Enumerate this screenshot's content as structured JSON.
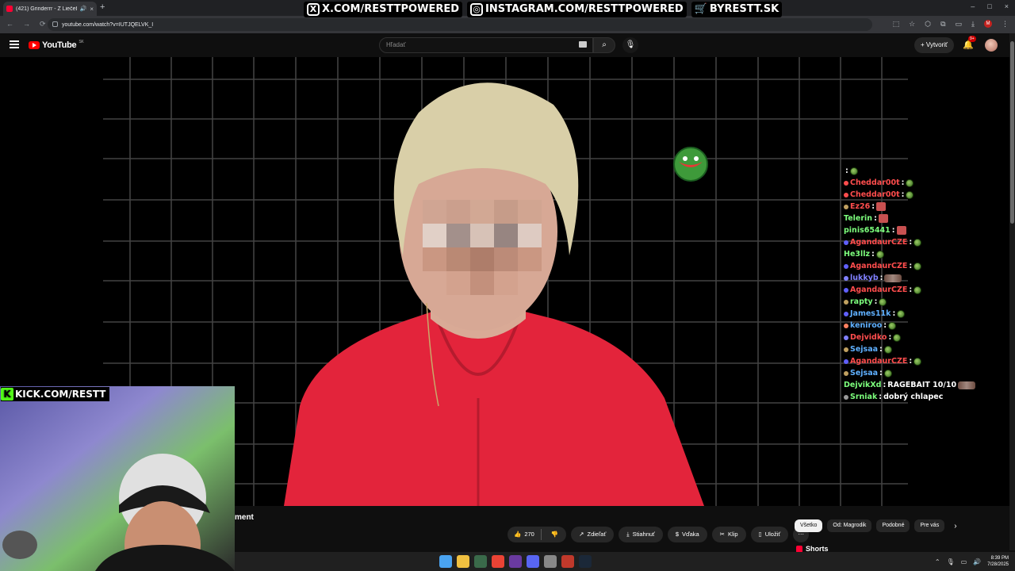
{
  "browser": {
    "tab_title": "(421) Grinderrr - Z Liečebr",
    "tab_close": "×",
    "new_tab": "+",
    "url": "youtube.com/watch?v=IUTJQELVK_I",
    "nav_icons": [
      "←",
      "→",
      "⟳"
    ],
    "window_controls": [
      "–",
      "□",
      "×"
    ],
    "profile_initial": "M"
  },
  "overlay": {
    "social": [
      {
        "icon": "x-icon",
        "glyph": "X",
        "text": "X.COM/RESTTPOWERED"
      },
      {
        "icon": "instagram-icon",
        "glyph": "◎",
        "text": "INSTAGRAM.COM/RESTTPOWERED"
      },
      {
        "icon": "cart-icon",
        "glyph": "🛒",
        "text": "BYRESTT.SK"
      }
    ],
    "kick": "KICK.COM/RESTT",
    "kick_glyph": "K"
  },
  "youtube": {
    "logo_text": "YouTube",
    "region": "SK",
    "search_placeholder": "Hľadať",
    "create_label": "Vytvoriť",
    "notifications": "9+",
    "title_fragment": "ment"
  },
  "chat": [
    {
      "user": "",
      "color": "#ff4d4d",
      "msg": "",
      "emote": "pepe"
    },
    {
      "user": "Cheddar00t",
      "color": "#ff4d4d",
      "badge": "#ff4d4d",
      "msg": "",
      "emote": "pepe"
    },
    {
      "user": "Cheddar00t",
      "color": "#ff4d4d",
      "badge": "#ff4d4d",
      "msg": "",
      "emote": "pepe"
    },
    {
      "user": "Ez26",
      "color": "#ff4d4d",
      "badge": "#c0a060",
      "msg": "",
      "emote": "face"
    },
    {
      "user": "Telerin",
      "color": "#7dff7d",
      "badge": "",
      "msg": "",
      "emote": "face"
    },
    {
      "user": "pinis65441",
      "color": "#7dff7d",
      "badge": "",
      "msg": "",
      "emote": "face"
    },
    {
      "user": "AgandaurCZE",
      "color": "#ff4d4d",
      "badge": "#6060ff",
      "msg": "",
      "emote": "pepe"
    },
    {
      "user": "He3llz",
      "color": "#7dff7d",
      "badge": "",
      "msg": "",
      "emote": "pepe"
    },
    {
      "user": "AgandaurCZE",
      "color": "#ff4d4d",
      "badge": "#6060ff",
      "msg": "",
      "emote": "pepe"
    },
    {
      "user": "lukkyb",
      "color": "#8080ff",
      "badge": "#8080ff",
      "msg": "",
      "emote": "wide"
    },
    {
      "user": "AgandaurCZE",
      "color": "#ff4d4d",
      "badge": "#6060ff",
      "msg": "",
      "emote": "pepe"
    },
    {
      "user": "rapty",
      "color": "#7dff7d",
      "badge": "#c0a060",
      "msg": "",
      "emote": "pepe"
    },
    {
      "user": "James11k",
      "color": "#5fb0ff",
      "badge": "#6060ff",
      "msg": "",
      "emote": "pepe"
    },
    {
      "user": "keniroo",
      "color": "#5fb0ff",
      "badge": "#ff8060",
      "msg": "",
      "emote": "pepe"
    },
    {
      "user": "Dejvidko",
      "color": "#ff4d4d",
      "badge": "#8080ff",
      "msg": "",
      "emote": "pepe"
    },
    {
      "user": "Sejsaa",
      "color": "#5fb0ff",
      "badge": "#c0a060",
      "msg": "",
      "emote": "pepe"
    },
    {
      "user": "AgandaurCZE",
      "color": "#ff4d4d",
      "badge": "#6060ff",
      "msg": "",
      "emote": "pepe"
    },
    {
      "user": "Sejsaa",
      "color": "#5fb0ff",
      "badge": "#c0a060",
      "msg": "",
      "emote": "pepe"
    },
    {
      "user": "DejvikXd",
      "color": "#7dff7d",
      "badge": "",
      "msg": "RAGEBAIT 10/10",
      "emote": "wide"
    },
    {
      "user": "Srniak",
      "color": "#7dff7d",
      "badge": "#999999",
      "msg": "dobrý chlapec",
      "emote": ""
    }
  ],
  "actions": {
    "likes": "270",
    "share": "Zdieľať",
    "download": "Stiahnuť",
    "thanks": "Vďaka",
    "clip": "Klip",
    "save": "Uložiť",
    "more": "⋯"
  },
  "chips": [
    "Všetko",
    "Od: Magrodik",
    "Podobné",
    "Pre vás"
  ],
  "shorts_label": "Shorts",
  "taskbar": {
    "time": "8:39 PM",
    "date": "7/28/2025",
    "app_colors": [
      "#4aa3f0",
      "#f0c040",
      "#3a6a4a",
      "#ea4335",
      "#6a3aa0",
      "#5865f2",
      "#888888",
      "#c0392b",
      "#1b2838"
    ]
  }
}
